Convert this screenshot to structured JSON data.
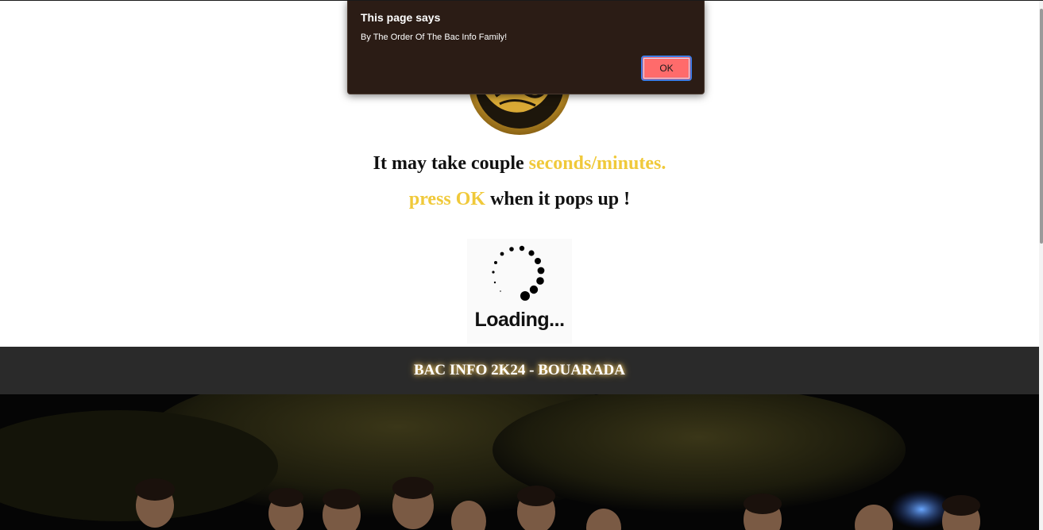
{
  "dialog": {
    "title": "This page says",
    "message": "By The Order Of The Bac Info Family!",
    "ok_label": "OK"
  },
  "main": {
    "line1_part1": "It may take couple ",
    "line1_accent": "seconds/minutes.",
    "line2_accent": "press OK",
    "line2_part2": " when it pops up !",
    "loading_text": "Loading..."
  },
  "footer": {
    "title": "BAC INFO 2K24 - BOUARADA"
  },
  "colors": {
    "accent": "#f0c93a",
    "footer_bg": "#2a2a2a",
    "dialog_bg": "#2b1c15",
    "ok_button": "#ff6b6b"
  },
  "icons": {
    "logo": "gold-emblem-logo",
    "loader": "spinner-dots-icon"
  }
}
